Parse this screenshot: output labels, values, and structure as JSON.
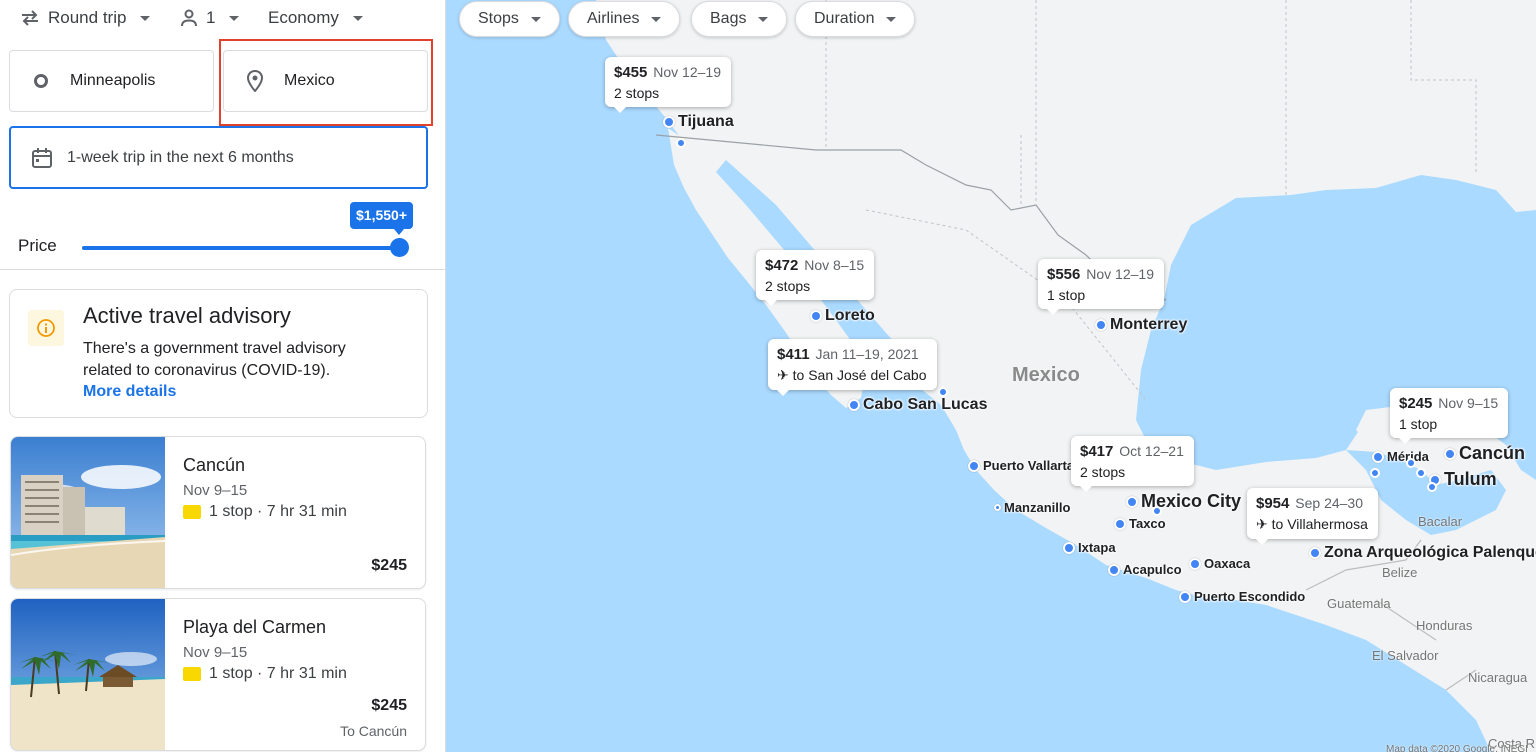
{
  "topbar": {
    "trip_type": "Round trip",
    "passengers": "1",
    "cabin": "Economy"
  },
  "search": {
    "origin": "Minneapolis",
    "destination": "Mexico",
    "dates": "1-week trip in the next 6 months"
  },
  "price_filter": {
    "label": "Price",
    "max_label": "$1,550+",
    "level_fraction": 1.0
  },
  "advisory": {
    "title": "Active travel advisory",
    "text": "There's a government travel advisory related to coronavirus (COVID-19).",
    "link": "More details"
  },
  "destinations": [
    {
      "name": "Cancún",
      "dates": "Nov 9–15",
      "stops": "1 stop · 7 hr 31 min",
      "price": "$245",
      "sub": ""
    },
    {
      "name": "Playa del Carmen",
      "dates": "Nov 9–15",
      "stops": "1 stop · 7 hr 31 min",
      "price": "$245",
      "sub": "To Cancún"
    }
  ],
  "filters": [
    "Stops",
    "Airlines",
    "Bags",
    "Duration"
  ],
  "map": {
    "country_label": "Mexico",
    "callouts": [
      {
        "price": "$455",
        "dates": "Nov 12–19",
        "detail": "2 stops"
      },
      {
        "price": "$472",
        "dates": "Nov 8–15",
        "detail": "2 stops"
      },
      {
        "price": "$556",
        "dates": "Nov 12–19",
        "detail": "1 stop"
      },
      {
        "price": "$411",
        "dates": "Jan 11–19, 2021",
        "detail": "to San José del Cabo"
      },
      {
        "price": "$245",
        "dates": "Nov 9–15",
        "detail": "1 stop"
      },
      {
        "price": "$417",
        "dates": "Oct 12–21",
        "detail": "2 stops"
      },
      {
        "price": "$954",
        "dates": "Sep 24–30",
        "detail": "to Villahermosa"
      }
    ],
    "cities": [
      "Tijuana",
      "Loreto",
      "Monterrey",
      "Cabo San Lucas",
      "Puerto Vallarta",
      "Mexico City",
      "Taxco",
      "Manzanillo",
      "Ixtapa",
      "Acapulco",
      "Oaxaca",
      "Puerto Escondido",
      "Mérida",
      "Cancún",
      "Tulum",
      "Zona Arqueológica Palenque"
    ],
    "labels": [
      "Bacalar",
      "Belize",
      "Guatemala",
      "Honduras",
      "El Salvador",
      "Nicaragua",
      "Costa R",
      "Map data ©2020 Google, INEGI"
    ]
  },
  "colors": {
    "accent": "#1a73e8",
    "highlight_border": "#e2422b",
    "water": "#aadaff",
    "land": "#f1f3f4"
  }
}
